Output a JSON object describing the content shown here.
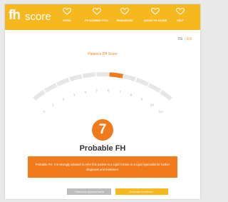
{
  "logo": {
    "part1": "fh",
    "part2": "score"
  },
  "nav": [
    {
      "id": "intro",
      "label": "INTRO",
      "icon": "home-heart-icon"
    },
    {
      "id": "fh-scoring-tool",
      "label": "FH SCORING TOOL",
      "icon": "bulb-heart-icon"
    },
    {
      "id": "resources",
      "label": "RESOURCES",
      "icon": "book-heart-icon"
    },
    {
      "id": "about",
      "label": "ABOUT FH SCORE",
      "icon": "info-heart-icon"
    },
    {
      "id": "help",
      "label": "HELP",
      "icon": "question-heart-icon"
    }
  ],
  "language": {
    "de": "DE",
    "sep": "|",
    "en": "EN",
    "active": "EN"
  },
  "gauge": {
    "title": "Patient's FH Score",
    "ticks": [
      "0",
      "1",
      "2",
      "3",
      "4",
      "5",
      "6",
      "7",
      "8",
      "9",
      "10",
      "11+"
    ],
    "value": 7,
    "colors": {
      "track": "#e6e6e6",
      "highlight": "#f07a1c",
      "tick_text": "#b0b0b0"
    }
  },
  "result": {
    "score": "7",
    "label": "Probable FH",
    "advice": "Probable FH. It is strongly advised to refer this patient to a Lipid Centre or a Lipid Specialist for further diagnosis and treatment."
  },
  "buttons": {
    "back": "‹   Return to questionnaire",
    "continue": "Continue to referral   ›"
  },
  "colors": {
    "brand": "#f6b81f",
    "accent": "#f07a1c"
  }
}
